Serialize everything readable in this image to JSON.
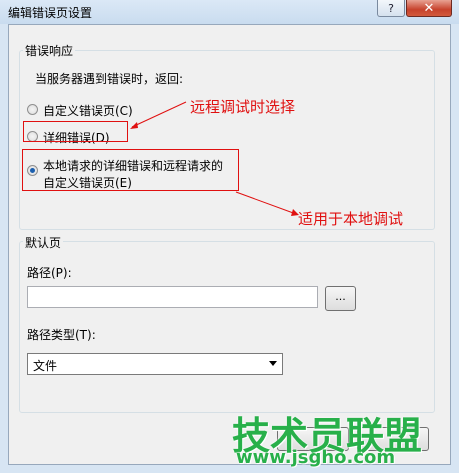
{
  "window": {
    "title": "编辑错误页设置",
    "help_glyph": "?",
    "close_glyph": "✕"
  },
  "error_response": {
    "group_label": "错误响应",
    "prompt": "当服务器遇到错误时，返回:",
    "options": [
      {
        "label": "自定义错误页(C)",
        "checked": false
      },
      {
        "label": "详细错误(D)",
        "checked": false
      },
      {
        "label_line1": "本地请求的详细错误和远程请求的",
        "label_line2": "自定义错误页(E)",
        "checked": true
      }
    ]
  },
  "default_page": {
    "group_label": "默认页",
    "path_label": "路径(P):",
    "path_value": "",
    "browse_label": "...",
    "path_type_label": "路径类型(T):",
    "path_type_value": "文件"
  },
  "annotations": {
    "remote": "远程调试时选择",
    "local": "适用于本地调试",
    "color": "#e01010"
  },
  "watermark": {
    "brand": "技术员联盟",
    "url": "www.jsgho.com",
    "color": "#28b04a"
  }
}
